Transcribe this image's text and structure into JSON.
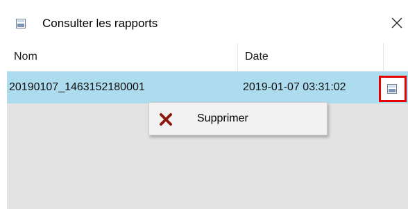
{
  "window": {
    "title": "Consulter les rapports",
    "icon": "report-window-icon",
    "close_glyph": "✕"
  },
  "table": {
    "columns": [
      "Nom",
      "Date"
    ],
    "rows": [
      {
        "nom": "20190107_1463152180001",
        "date": "2019-01-07 03:31:02",
        "selected": true,
        "action_icon": "report-view-icon"
      }
    ]
  },
  "context_menu": {
    "items": [
      {
        "label": "Supprimer",
        "icon": "delete-x-icon",
        "icon_color": "#8b1a10"
      }
    ]
  },
  "colors": {
    "selected_row": "#acdced",
    "list_background": "#e3e3e3",
    "highlight_border": "#e60000"
  }
}
